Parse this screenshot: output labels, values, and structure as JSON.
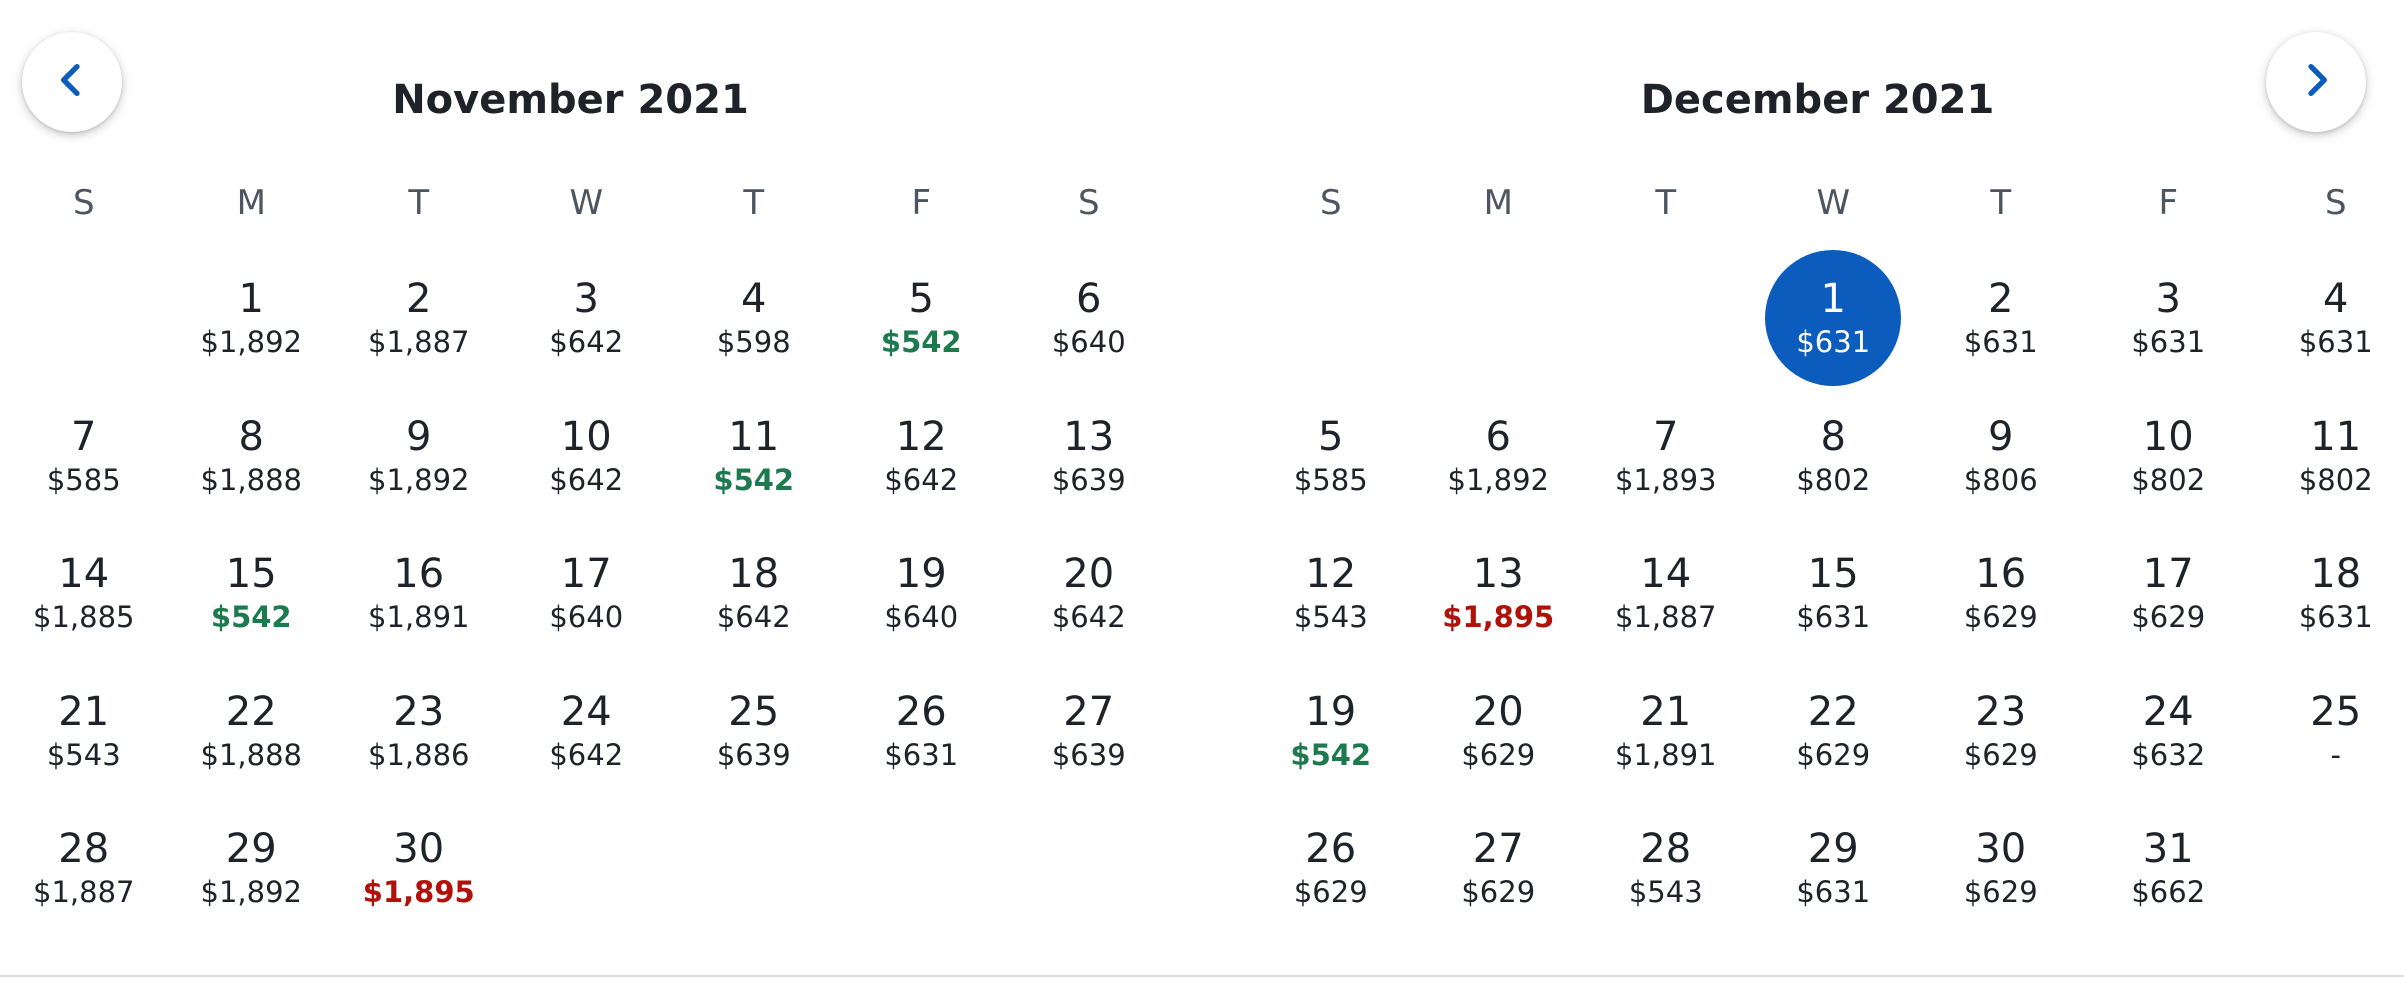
{
  "nav": {
    "prev_icon": "chevron-left-icon",
    "next_icon": "chevron-right-icon",
    "icon_color": "#0b5cbd"
  },
  "colors": {
    "selected": "#0b5cbd",
    "lowest_price": "#1d7a4f",
    "highest_price": "#b0120a",
    "text": "#1f2329",
    "weekday_text": "#4d5560"
  },
  "months": [
    {
      "title": "November 2021",
      "weekdays": [
        "S",
        "M",
        "T",
        "W",
        "T",
        "F",
        "S"
      ],
      "days": [
        null,
        {
          "day": "1",
          "price": "$1,892"
        },
        {
          "day": "2",
          "price": "$1,887"
        },
        {
          "day": "3",
          "price": "$642"
        },
        {
          "day": "4",
          "price": "$598"
        },
        {
          "day": "5",
          "price": "$542",
          "status": "low"
        },
        {
          "day": "6",
          "price": "$640"
        },
        {
          "day": "7",
          "price": "$585"
        },
        {
          "day": "8",
          "price": "$1,888"
        },
        {
          "day": "9",
          "price": "$1,892"
        },
        {
          "day": "10",
          "price": "$642"
        },
        {
          "day": "11",
          "price": "$542",
          "status": "low"
        },
        {
          "day": "12",
          "price": "$642"
        },
        {
          "day": "13",
          "price": "$639"
        },
        {
          "day": "14",
          "price": "$1,885"
        },
        {
          "day": "15",
          "price": "$542",
          "status": "low"
        },
        {
          "day": "16",
          "price": "$1,891"
        },
        {
          "day": "17",
          "price": "$640"
        },
        {
          "day": "18",
          "price": "$642"
        },
        {
          "day": "19",
          "price": "$640"
        },
        {
          "day": "20",
          "price": "$642"
        },
        {
          "day": "21",
          "price": "$543"
        },
        {
          "day": "22",
          "price": "$1,888"
        },
        {
          "day": "23",
          "price": "$1,886"
        },
        {
          "day": "24",
          "price": "$642"
        },
        {
          "day": "25",
          "price": "$639"
        },
        {
          "day": "26",
          "price": "$631"
        },
        {
          "day": "27",
          "price": "$639"
        },
        {
          "day": "28",
          "price": "$1,887"
        },
        {
          "day": "29",
          "price": "$1,892"
        },
        {
          "day": "30",
          "price": "$1,895",
          "status": "high"
        }
      ]
    },
    {
      "title": "December 2021",
      "weekdays": [
        "S",
        "M",
        "T",
        "W",
        "T",
        "F",
        "S"
      ],
      "days": [
        null,
        null,
        null,
        {
          "day": "1",
          "price": "$631",
          "selected": true
        },
        {
          "day": "2",
          "price": "$631"
        },
        {
          "day": "3",
          "price": "$631"
        },
        {
          "day": "4",
          "price": "$631"
        },
        {
          "day": "5",
          "price": "$585"
        },
        {
          "day": "6",
          "price": "$1,892"
        },
        {
          "day": "7",
          "price": "$1,893"
        },
        {
          "day": "8",
          "price": "$802"
        },
        {
          "day": "9",
          "price": "$806"
        },
        {
          "day": "10",
          "price": "$802"
        },
        {
          "day": "11",
          "price": "$802"
        },
        {
          "day": "12",
          "price": "$543"
        },
        {
          "day": "13",
          "price": "$1,895",
          "status": "high"
        },
        {
          "day": "14",
          "price": "$1,887"
        },
        {
          "day": "15",
          "price": "$631"
        },
        {
          "day": "16",
          "price": "$629"
        },
        {
          "day": "17",
          "price": "$629"
        },
        {
          "day": "18",
          "price": "$631"
        },
        {
          "day": "19",
          "price": "$542",
          "status": "low"
        },
        {
          "day": "20",
          "price": "$629"
        },
        {
          "day": "21",
          "price": "$1,891"
        },
        {
          "day": "22",
          "price": "$629"
        },
        {
          "day": "23",
          "price": "$629"
        },
        {
          "day": "24",
          "price": "$632"
        },
        {
          "day": "25",
          "price": "-"
        },
        {
          "day": "26",
          "price": "$629"
        },
        {
          "day": "27",
          "price": "$629"
        },
        {
          "day": "28",
          "price": "$543"
        },
        {
          "day": "29",
          "price": "$631"
        },
        {
          "day": "30",
          "price": "$629"
        },
        {
          "day": "31",
          "price": "$662"
        }
      ]
    }
  ]
}
